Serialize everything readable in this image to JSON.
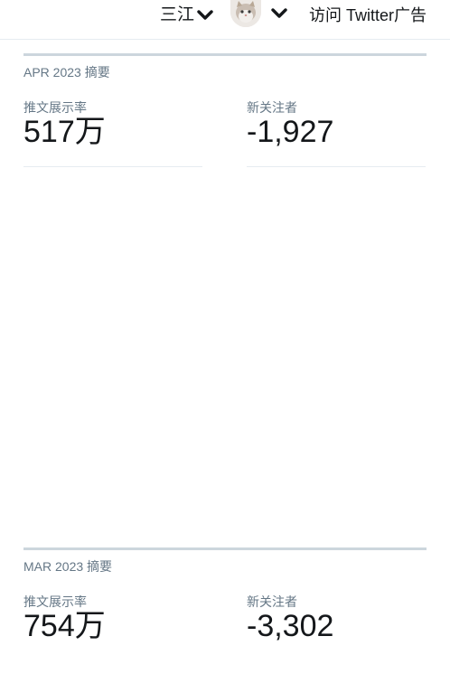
{
  "header": {
    "account_name": "三江",
    "ads_link": "访问 Twitter广告",
    "icons": {
      "account_dropdown": "chevron-down-icon",
      "avatar_dropdown": "chevron-down-icon"
    }
  },
  "summaries": [
    {
      "title": "APR 2023 摘要",
      "metrics": [
        {
          "label": "推文展示率",
          "value": "517万"
        },
        {
          "label": "新关注者",
          "value": "-1,927"
        }
      ]
    },
    {
      "title": "MAR 2023 摘要",
      "metrics": [
        {
          "label": "推文展示率",
          "value": "754万"
        },
        {
          "label": "新关注者",
          "value": "-3,302"
        }
      ]
    }
  ],
  "colors": {
    "text_primary": "#14171a",
    "text_secondary": "#657786",
    "rule": "#ccd6dd",
    "divider": "#e6ecf0"
  }
}
